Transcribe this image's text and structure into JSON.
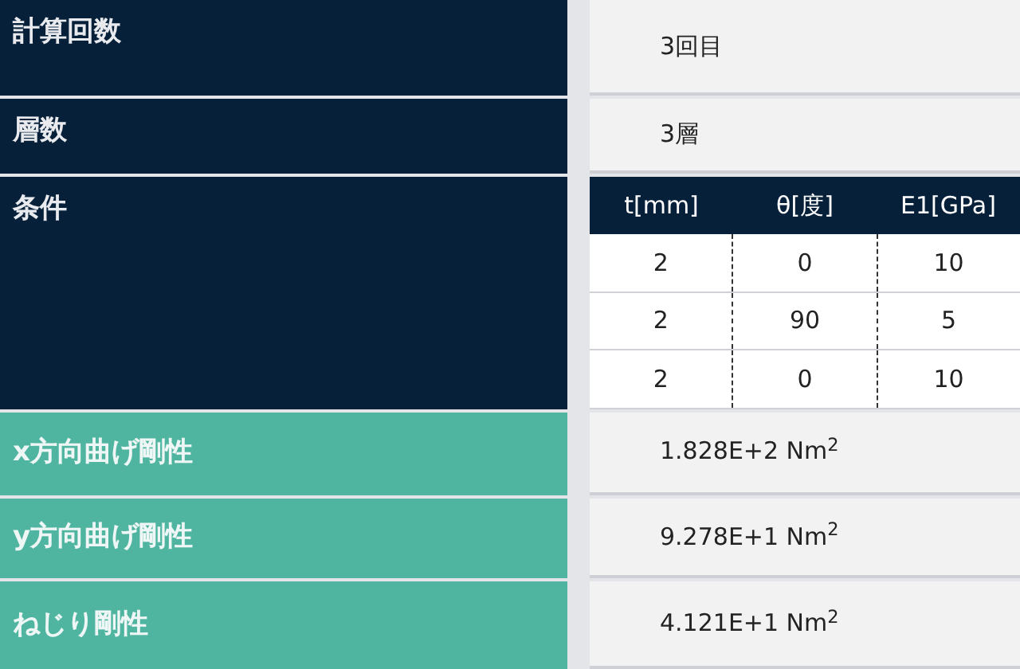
{
  "rows": [
    {
      "label": "計算回数",
      "kind": "input",
      "value": "3回目"
    },
    {
      "label": "層数",
      "kind": "input",
      "value": "3層"
    },
    {
      "label": "条件",
      "kind": "input",
      "table": {
        "columns": [
          "t[mm]",
          "θ[度]",
          "E1[GPa]"
        ],
        "rows": [
          [
            "2",
            "0",
            "10"
          ],
          [
            "2",
            "90",
            "5"
          ],
          [
            "2",
            "0",
            "10"
          ]
        ]
      }
    },
    {
      "label": "x方向曲げ剛性",
      "kind": "output",
      "value": "1.828E+2 Nm$^{2}$"
    },
    {
      "label": "y方向曲げ剛性",
      "kind": "output",
      "value": "9.278E+1 Nm$^{2}$"
    },
    {
      "label": "ねじり剛性",
      "kind": "output",
      "value": "4.121E+1 Nm$^{2}$"
    }
  ]
}
